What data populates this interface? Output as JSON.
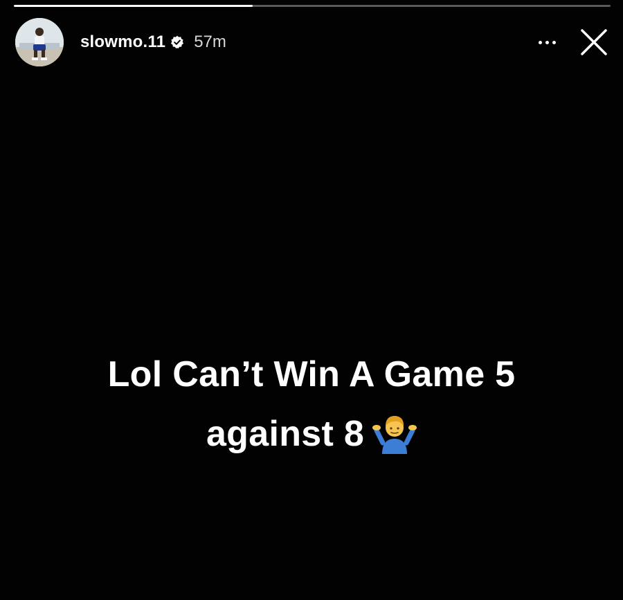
{
  "story": {
    "progress_fraction": 0.4,
    "colors": {
      "background": "#020202",
      "text": "#ffffff",
      "progress_track": "#5a5a5a",
      "progress_fill": "#ffffff"
    }
  },
  "header": {
    "avatar_icon": "profile-photo",
    "username": "slowmo.11",
    "verified_icon": "verified-badge-icon",
    "time_ago": "57m",
    "more_icon": "more-options-icon",
    "close_icon": "close-icon"
  },
  "caption": {
    "line1": "Lol Can’t Win A Game 5",
    "line2": "against 8",
    "emoji_icon": "person-shrugging-emoji"
  }
}
